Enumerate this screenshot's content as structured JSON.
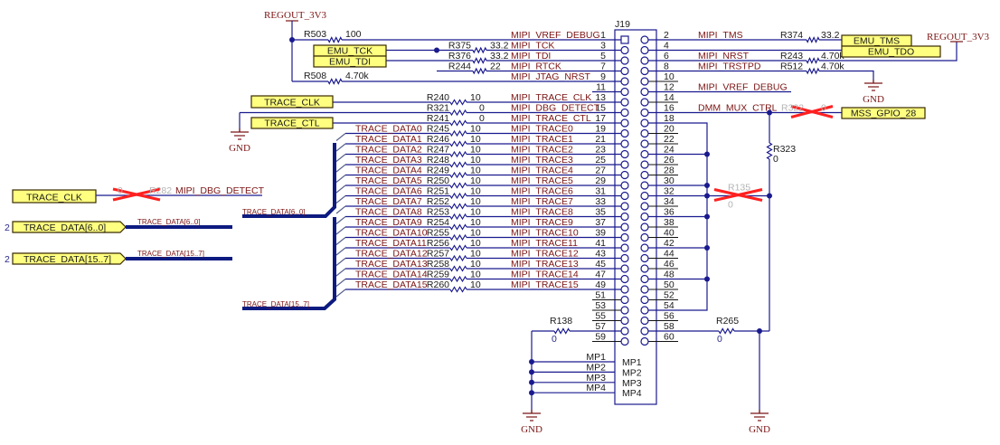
{
  "power": {
    "regout_3v3": "REGOUT_3V3",
    "gnd": "GND"
  },
  "connector": {
    "ref": "J19",
    "mounting_pins": [
      "MP1",
      "MP2",
      "MP3",
      "MP4"
    ]
  },
  "left_pins": [
    {
      "pin": "1",
      "net": "MIPI_VREF_DEBUG",
      "res": "R503",
      "val": "100"
    },
    {
      "pin": "3",
      "net": "MIPI_TCK",
      "res": "R375",
      "val": "33.2"
    },
    {
      "pin": "5",
      "net": "MIPI_TDI",
      "res": "R376",
      "val": "33.2"
    },
    {
      "pin": "7",
      "net": "MIPI_RTCK",
      "res": "R244",
      "val": "22"
    },
    {
      "pin": "9",
      "net": "MIPI_JTAG_NRST",
      "res": "R508",
      "val": "4.70k"
    },
    {
      "pin": "11"
    },
    {
      "pin": "13",
      "net": "MIPI_TRACE_CLK",
      "res": "R240",
      "val": "10"
    },
    {
      "pin": "15",
      "net": "MIPI_DBG_DETECT",
      "res": "R321",
      "val": "0"
    },
    {
      "pin": "17",
      "net": "MIPI_TRACE_CTL",
      "res": "R241",
      "val": "0"
    },
    {
      "pin": "19",
      "net": "MIPI_TRACE0",
      "res": "R245",
      "val": "10",
      "src": "TRACE_DATA0"
    },
    {
      "pin": "21",
      "net": "MIPI_TRACE1",
      "res": "R246",
      "val": "10",
      "src": "TRACE_DATA1"
    },
    {
      "pin": "23",
      "net": "MIPI_TRACE2",
      "res": "R247",
      "val": "10",
      "src": "TRACE_DATA2"
    },
    {
      "pin": "25",
      "net": "MIPI_TRACE3",
      "res": "R248",
      "val": "10",
      "src": "TRACE_DATA3"
    },
    {
      "pin": "27",
      "net": "MIPI_TRACE4",
      "res": "R249",
      "val": "10",
      "src": "TRACE_DATA4"
    },
    {
      "pin": "29",
      "net": "MIPI_TRACE5",
      "res": "R250",
      "val": "10",
      "src": "TRACE_DATA5"
    },
    {
      "pin": "31",
      "net": "MIPI_TRACE6",
      "res": "R251",
      "val": "10",
      "src": "TRACE_DATA6"
    },
    {
      "pin": "33",
      "net": "MIPI_TRACE7",
      "res": "R252",
      "val": "10",
      "src": "TRACE_DATA7"
    },
    {
      "pin": "35",
      "net": "MIPI_TRACE8",
      "res": "R253",
      "val": "10",
      "src": "TRACE_DATA8"
    },
    {
      "pin": "37",
      "net": "MIPI_TRACE9",
      "res": "R254",
      "val": "10",
      "src": "TRACE_DATA9"
    },
    {
      "pin": "39",
      "net": "MIPI_TRACE10",
      "res": "R255",
      "val": "10",
      "src": "TRACE_DATA10"
    },
    {
      "pin": "41",
      "net": "MIPI_TRACE11",
      "res": "R256",
      "val": "10",
      "src": "TRACE_DATA11"
    },
    {
      "pin": "43",
      "net": "MIPI_TRACE12",
      "res": "R257",
      "val": "10",
      "src": "TRACE_DATA12"
    },
    {
      "pin": "45",
      "net": "MIPI_TRACE13",
      "res": "R258",
      "val": "10",
      "src": "TRACE_DATA13"
    },
    {
      "pin": "47",
      "net": "MIPI_TRACE14",
      "res": "R259",
      "val": "10",
      "src": "TRACE_DATA14"
    },
    {
      "pin": "49",
      "net": "MIPI_TRACE15",
      "res": "R260",
      "val": "10",
      "src": "TRACE_DATA15"
    },
    {
      "pin": "51"
    },
    {
      "pin": "53"
    },
    {
      "pin": "55"
    },
    {
      "pin": "57",
      "res": "R138",
      "val": "0"
    },
    {
      "pin": "59"
    }
  ],
  "right_pins": [
    {
      "pin": "2",
      "net": "MIPI_TMS",
      "res": "R374",
      "val": "33.2"
    },
    {
      "pin": "4"
    },
    {
      "pin": "6",
      "net": "MIPI_NRST",
      "res": "R243",
      "val": "4.70k"
    },
    {
      "pin": "8",
      "net": "MIPI_TRSTPD",
      "res": "R512",
      "val": "4.70k"
    },
    {
      "pin": "10"
    },
    {
      "pin": "12",
      "net": "MIPI_VREF_DEBUG"
    },
    {
      "pin": "14"
    },
    {
      "pin": "16",
      "net": "DMM_MUX_CTRL",
      "res": "R322",
      "val": "0",
      "dnp": true
    },
    {
      "pin": "18"
    },
    {
      "pin": "20"
    },
    {
      "pin": "22"
    },
    {
      "pin": "24"
    },
    {
      "pin": "26"
    },
    {
      "pin": "28"
    },
    {
      "pin": "30"
    },
    {
      "pin": "32"
    },
    {
      "pin": "34"
    },
    {
      "pin": "36"
    },
    {
      "pin": "38"
    },
    {
      "pin": "40"
    },
    {
      "pin": "42"
    },
    {
      "pin": "44"
    },
    {
      "pin": "46"
    },
    {
      "pin": "48"
    },
    {
      "pin": "50"
    },
    {
      "pin": "52"
    },
    {
      "pin": "54"
    },
    {
      "pin": "56"
    },
    {
      "pin": "58",
      "res": "R265",
      "val": "0"
    },
    {
      "pin": "60"
    }
  ],
  "net_labels": {
    "emu_tck": "EMU_TCK",
    "emu_tdi": "EMU_TDI",
    "emu_tms": "EMU_TMS",
    "emu_tdo": "EMU_TDO",
    "trace_clk": "TRACE_CLK",
    "trace_ctl": "TRACE_CTL",
    "mss_gpio_28": "MSS_GPIO_28",
    "trace_clk_left": "TRACE_CLK",
    "mipi_dbg_detect_left": "MIPI_DBG_DETECT"
  },
  "extra_parts": {
    "r282": {
      "ref": "R282",
      "val": "0",
      "dnp": true
    },
    "r323": {
      "ref": "R323",
      "val": "0"
    },
    "r135": {
      "ref": "R135",
      "val": "0",
      "dnp": true
    }
  },
  "ports": [
    {
      "label": "TRACE_DATA[6..0]",
      "sheet": "2",
      "wire_label": "TRACE_DATA[6..0]"
    },
    {
      "label": "TRACE_DATA[15..7]",
      "sheet": "2",
      "wire_label": "TRACE_DATA[15..7]"
    }
  ],
  "bus_labels": [
    "TRACE_DATA[6..0]",
    "TRACE_DATA[15..7]"
  ],
  "colors": {
    "wire": "#1a1a8f",
    "net_text": "#7b1414",
    "label_fill": "#ffff80",
    "dnp_cross": "#ff2020"
  }
}
